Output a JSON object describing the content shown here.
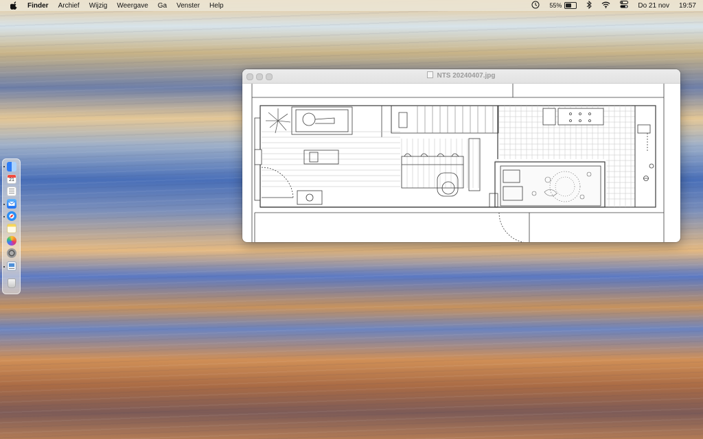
{
  "menubar": {
    "app_name": "Finder",
    "items": [
      "Archief",
      "Wijzig",
      "Weergave",
      "Ga",
      "Venster",
      "Help"
    ],
    "battery_percent": "55%",
    "battery_level": 0.55,
    "date": "Do 21 nov",
    "time": "19:57"
  },
  "dock": {
    "calendar_day": "21",
    "icons": [
      "finder-icon",
      "calendar-icon",
      "reminders-icon",
      "mail-icon",
      "safari-icon",
      "notes-icon",
      "photos-icon",
      "system-settings-icon",
      "preview-icon",
      "trash-icon"
    ]
  },
  "window": {
    "title": "NTS 20240407.jpg"
  },
  "colors": {
    "menubar_bg": "#ece8da",
    "window_bg": "#ffffff",
    "plan_line": "#3a3a3a"
  }
}
